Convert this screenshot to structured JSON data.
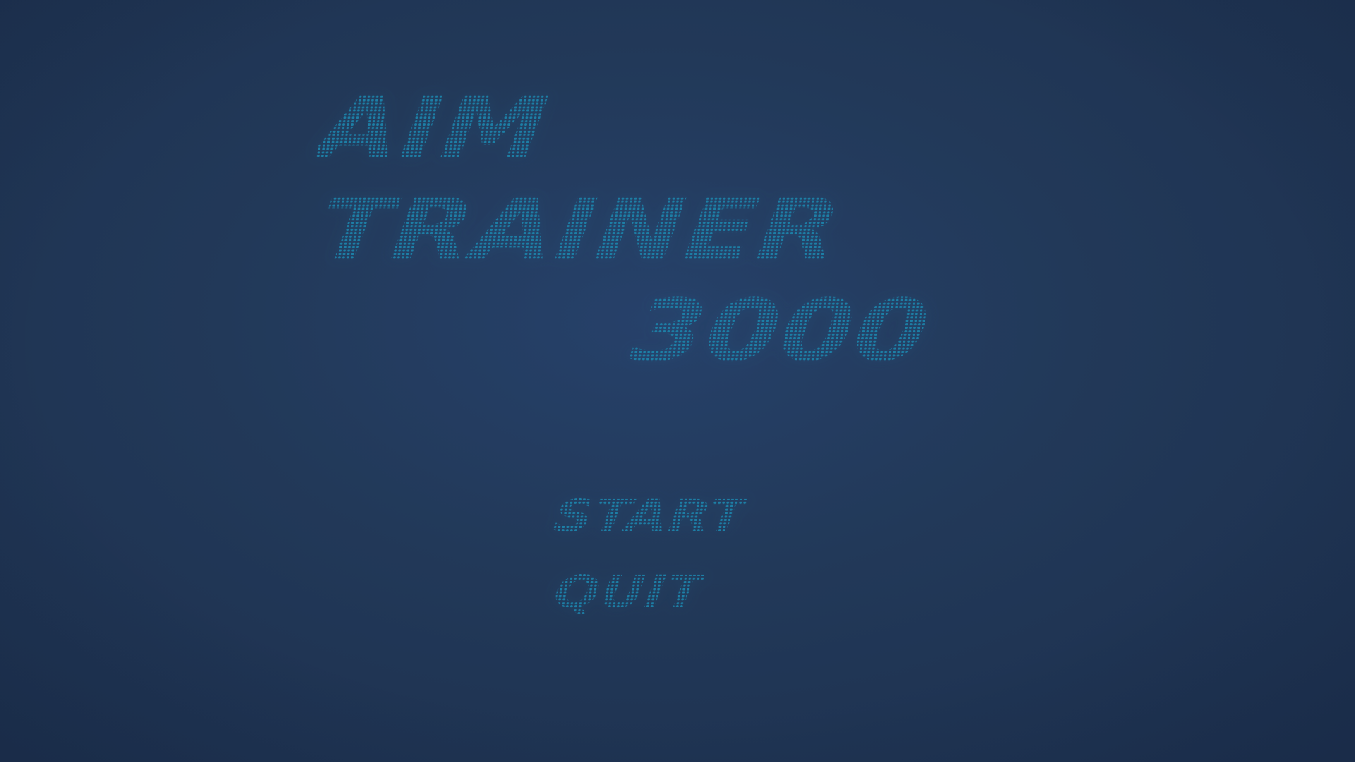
{
  "title": {
    "line1": "AIM",
    "line2": "TRAINER",
    "line3": "3000"
  },
  "menu": {
    "start_label": "START",
    "quit_label": "QUIT"
  },
  "colors": {
    "background": "#223959",
    "text_dots": "#1d7fa6"
  }
}
